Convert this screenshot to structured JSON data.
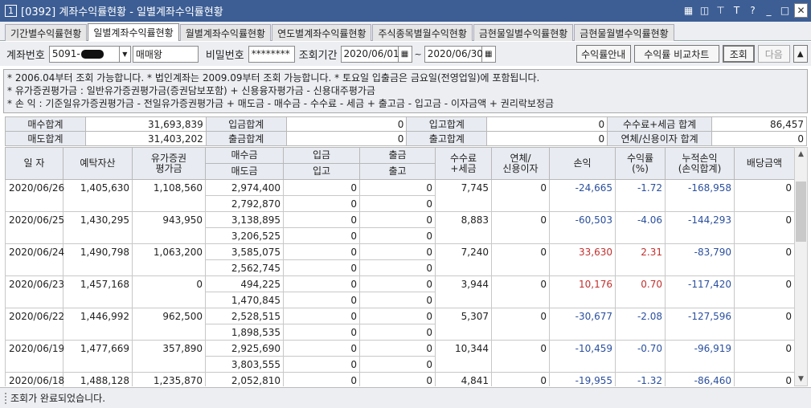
{
  "window": {
    "number": "1",
    "title": "[0392] 계좌수익률현황 - 일별계좌수익률현황"
  },
  "tabs": [
    "기간별수익률현황",
    "일별계좌수익률현황",
    "월별계좌수익률현황",
    "연도별계좌수익률현황",
    "주식종목별월수익현황",
    "금현물일별수익률현황",
    "금현물월별수익률현황"
  ],
  "form": {
    "account_label": "계좌번호",
    "account_value": "5091-",
    "account_name": "매매왕",
    "password_label": "비밀번호",
    "password_value": "********",
    "period_label": "조회기간",
    "date_from": "2020/06/01",
    "tilde": "~",
    "date_to": "2020/06/30",
    "btn_guide": "수익률안내",
    "btn_compare": "수익률 비교차트",
    "btn_query": "조회",
    "btn_next": "다음",
    "btn_up": "▲"
  },
  "notes": [
    "* 2006.04부터 조회 가능합니다.   * 법인계좌는 2009.09부터 조회 가능합니다.   * 토요일 입출금은 금요일(전영업일)에 포함됩니다.",
    "* 유가증권평가금 : 일반유가증권평가금(증권담보포함) + 신용융자평가금 - 신용대주평가금",
    "* 손          익 : 기준일유가증권평가금 - 전일유가증권평가금 + 매도금 - 매수금 - 수수료 - 세금 + 출고금 - 입고금 - 이자금액 + 권리락보정금"
  ],
  "summary": {
    "buy_total_label": "매수합계",
    "buy_total": "31,693,839",
    "deposit_total_label": "입금합계",
    "deposit_total": "0",
    "in_total_label": "입고합계",
    "in_total": "0",
    "fee_total_label": "수수료+세금 합계",
    "fee_total": "86,457",
    "sell_total_label": "매도합계",
    "sell_total": "31,403,202",
    "withdraw_total_label": "출금합계",
    "withdraw_total": "0",
    "out_total_label": "출고합계",
    "out_total": "0",
    "interest_total_label": "연체/신용이자 합계",
    "interest_total": "0"
  },
  "table": {
    "headers": {
      "date": "일 자",
      "deposit": "예탁자산",
      "securities": "유가증권\n평가금",
      "buy": "매수금",
      "sell": "매도금",
      "in_money": "입금",
      "in_stock": "입고",
      "out_money": "출금",
      "out_stock": "출고",
      "fee": "수수료\n+세금",
      "interest": "연체/\n신용이자",
      "pnl": "손익",
      "rate": "수익률\n(%)",
      "cum": "누적손익\n(손익합계)",
      "dividend": "배당금액"
    },
    "rows": [
      {
        "date": "2020/06/26",
        "deposit": "1,405,630",
        "securities": "1,108,560",
        "buy": "2,974,400",
        "sell": "2,792,870",
        "in1": "0",
        "in2": "0",
        "out1": "0",
        "out2": "0",
        "fee": "7,745",
        "interest": "0",
        "pnl": "-24,665",
        "rate": "-1.72",
        "cum": "-168,958",
        "dividend": "0",
        "sign": "neg"
      },
      {
        "date": "2020/06/25",
        "deposit": "1,430,295",
        "securities": "943,950",
        "buy": "3,138,895",
        "sell": "3,206,525",
        "in1": "0",
        "in2": "0",
        "out1": "0",
        "out2": "0",
        "fee": "8,883",
        "interest": "0",
        "pnl": "-60,503",
        "rate": "-4.06",
        "cum": "-144,293",
        "dividend": "0",
        "sign": "neg"
      },
      {
        "date": "2020/06/24",
        "deposit": "1,490,798",
        "securities": "1,063,200",
        "buy": "3,585,075",
        "sell": "2,562,745",
        "in1": "0",
        "in2": "0",
        "out1": "0",
        "out2": "0",
        "fee": "7,240",
        "interest": "0",
        "pnl": "33,630",
        "rate": "2.31",
        "cum": "-83,790",
        "dividend": "0",
        "sign": "pos"
      },
      {
        "date": "2020/06/23",
        "deposit": "1,457,168",
        "securities": "0",
        "buy": "494,225",
        "sell": "1,470,845",
        "in1": "0",
        "in2": "0",
        "out1": "0",
        "out2": "0",
        "fee": "3,944",
        "interest": "0",
        "pnl": "10,176",
        "rate": "0.70",
        "cum": "-117,420",
        "dividend": "0",
        "sign": "pos"
      },
      {
        "date": "2020/06/22",
        "deposit": "1,446,992",
        "securities": "962,500",
        "buy": "2,528,515",
        "sell": "1,898,535",
        "in1": "0",
        "in2": "0",
        "out1": "0",
        "out2": "0",
        "fee": "5,307",
        "interest": "0",
        "pnl": "-30,677",
        "rate": "-2.08",
        "cum": "-127,596",
        "dividend": "0",
        "sign": "neg"
      },
      {
        "date": "2020/06/19",
        "deposit": "1,477,669",
        "securities": "357,890",
        "buy": "2,925,690",
        "sell": "3,803,555",
        "in1": "0",
        "in2": "0",
        "out1": "0",
        "out2": "0",
        "fee": "10,344",
        "interest": "0",
        "pnl": "-10,459",
        "rate": "-0.70",
        "cum": "-96,919",
        "dividend": "0",
        "sign": "neg"
      },
      {
        "date": "2020/06/18",
        "deposit": "1,488,128",
        "securities": "1,235,870",
        "buy": "2,052,810",
        "sell": "",
        "in1": "0",
        "in2": "",
        "out1": "0",
        "out2": "",
        "fee": "4,841",
        "interest": "0",
        "pnl": "-19,955",
        "rate": "-1.32",
        "cum": "-86,460",
        "dividend": "0",
        "sign": "neg"
      }
    ]
  },
  "status": {
    "text": "조회가 완료되었습니다."
  },
  "colors": {
    "titlebar": "#3d5e94",
    "negative": "#2a4f9e",
    "positive": "#c0302e",
    "header_bg": "#e8ebf1"
  }
}
